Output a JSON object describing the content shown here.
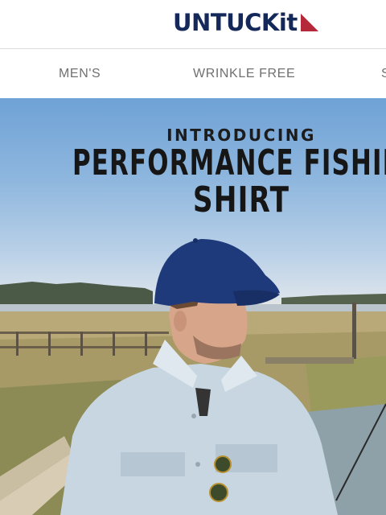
{
  "header": {
    "logo_text": "UNTUCKit",
    "brand_colors": {
      "navy": "#14285a",
      "red": "#b5283a"
    }
  },
  "nav": {
    "items": [
      {
        "label": "MEN'S"
      },
      {
        "label": "WRINKLE FREE"
      },
      {
        "label": "S"
      }
    ]
  },
  "hero": {
    "kicker": "INTRODUCING",
    "title_line1": "PERFORMANCE FISHING",
    "title_line2": "SHIRT"
  }
}
